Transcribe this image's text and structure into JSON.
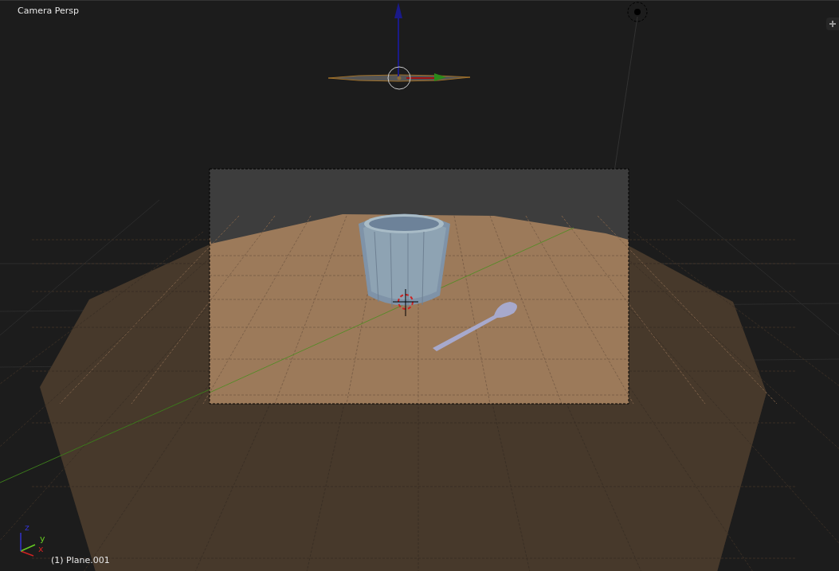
{
  "viewport": {
    "view_label": "Camera Persp",
    "object_label": "(1) Plane.001",
    "axis_labels": [
      "x",
      "y",
      "z"
    ]
  }
}
